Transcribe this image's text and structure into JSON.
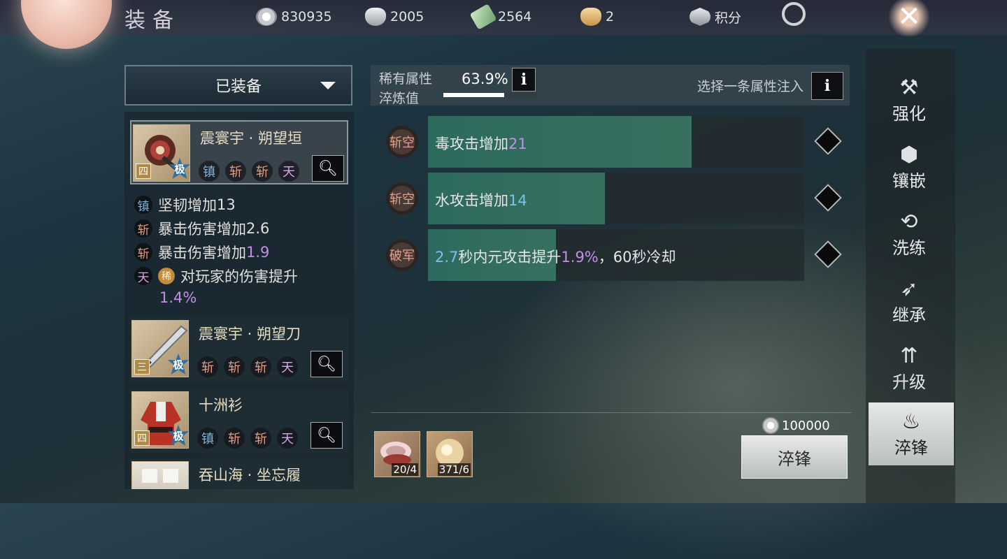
{
  "header": {
    "title": "装备",
    "currencies": [
      {
        "icon": "coin-icon",
        "value": "830935"
      },
      {
        "icon": "silver-ingot-icon",
        "value": "2005"
      },
      {
        "icon": "jade-ticket-icon",
        "value": "2564"
      },
      {
        "icon": "gold-ingot-icon",
        "value": "2"
      }
    ],
    "points_label": "积分",
    "close_label": "✕"
  },
  "left": {
    "filter_label": "已装备",
    "items": [
      {
        "name": "震寰宇 · 朔望垣",
        "tier": "四",
        "grade": "极",
        "tags": [
          "镇",
          "斩",
          "斩",
          "天"
        ]
      },
      {
        "name": "震寰宇 · 朔望刀",
        "tier": "三",
        "grade": "极",
        "tags": [
          "斩",
          "斩",
          "斩",
          "天"
        ]
      },
      {
        "name": "十洲衫",
        "tier": "四",
        "grade": "极",
        "tags": [
          "镇",
          "斩",
          "斩",
          "天"
        ]
      },
      {
        "name": "吞山海 · 坐忘履"
      }
    ],
    "stats": [
      {
        "tag": "镇",
        "text": "坚韧增加",
        "value": "13"
      },
      {
        "tag": "斩",
        "text": "暴击伤害增加",
        "value": "2.6"
      },
      {
        "tag": "斩",
        "text": "暴击伤害增加",
        "value": "1.9"
      },
      {
        "tag": "天",
        "rare": "稀",
        "text": "对玩家的伤害提升",
        "value": "1.4%"
      }
    ]
  },
  "center": {
    "rare_label": "稀有属性",
    "temper_label": "淬炼值",
    "temper_pct": "63.9%",
    "temper_fraction": 0.639,
    "info_label": "i",
    "hint": "选择一条属性注入",
    "attributes": [
      {
        "badge": "斩空",
        "text": "毒攻击增加",
        "value": "21",
        "fill": 0.7
      },
      {
        "badge": "斩空",
        "text": "水攻击增加",
        "value": "14",
        "fill": 0.47
      },
      {
        "badge": "破军",
        "value_a": "2.7",
        "text_a": "秒内元攻击提升",
        "value_b": "1.9%",
        "text_b": "，60秒冷却",
        "fill": 0.34
      }
    ],
    "materials": [
      {
        "icon": "shell-material-icon",
        "count": "20/4"
      },
      {
        "icon": "pearl-material-icon",
        "count": "371/6"
      }
    ],
    "cost": "100000",
    "action_label": "淬锋"
  },
  "nav": [
    {
      "icon": "hammer-icon",
      "label": "强化"
    },
    {
      "icon": "gem-icon",
      "label": "镶嵌"
    },
    {
      "icon": "refresh-icon",
      "label": "洗练"
    },
    {
      "icon": "inherit-icon",
      "label": "继承"
    },
    {
      "icon": "upgrade-icon",
      "label": "升级"
    },
    {
      "icon": "flame-blade-icon",
      "label": "淬锋",
      "active": true
    }
  ],
  "colors": {
    "accent_purple": "#c38ee6",
    "accent_blue": "#79c3e8",
    "bar_fill": "#2d6a5e"
  }
}
